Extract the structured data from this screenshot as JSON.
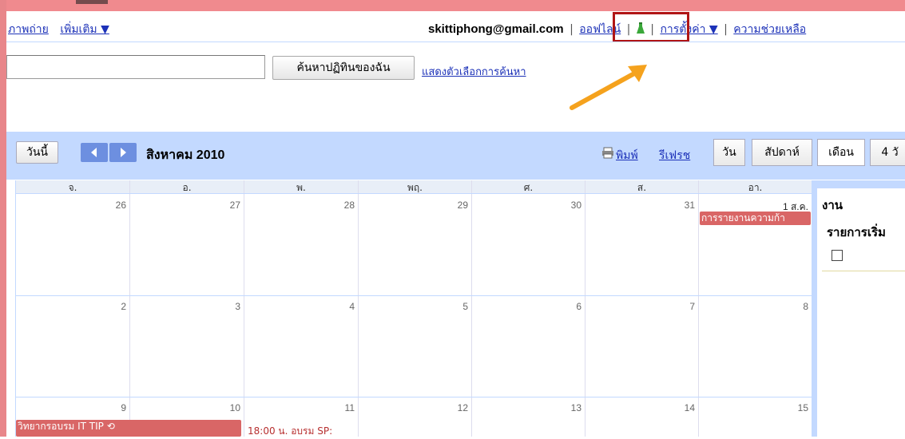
{
  "topnav": {
    "photos": "ภาพถ่าย",
    "more": "เพิ่มเติม ▼"
  },
  "account": {
    "email": "skittiphong@gmail.com",
    "offline": "ออฟไลน์",
    "settings": "การตั้งค่า ▼",
    "help": "ความช่วยเหลือ",
    "separator": "|"
  },
  "search": {
    "value": "",
    "button_label": "ค้นหาปฏิทินของฉัน",
    "options_link": "แสดงตัวเลือกการค้นหา"
  },
  "toolbar": {
    "today": "วันนี้",
    "month_title": "สิงหาคม 2010",
    "print": "พิมพ์",
    "refresh": "รีเฟรช",
    "views": [
      "วัน",
      "สัปดาห์",
      "เดือน",
      "4 วั"
    ],
    "active_view": "เดือน"
  },
  "calendar": {
    "weekdays": [
      "จ.",
      "อ.",
      "พ.",
      "พฤ.",
      "ศ.",
      "ส.",
      "อา."
    ],
    "weeks": [
      [
        "26",
        "27",
        "28",
        "29",
        "30",
        "31",
        "1 ส.ค."
      ],
      [
        "2",
        "3",
        "4",
        "5",
        "6",
        "7",
        "8"
      ],
      [
        "9",
        "10",
        "11",
        "12",
        "13",
        "14",
        "15"
      ]
    ],
    "events": {
      "aug1": "การรายงานความก้า",
      "aug9": "วิทยากรอบรม IT TIP ⟲",
      "aug11": "18:00 น. อบรม SP:"
    }
  },
  "tasks": {
    "title": "งาน",
    "list_title": "รายการเริ่ม"
  },
  "colors": {
    "accent": "#c3d9ff",
    "nav_button": "#6d8fe0",
    "event": "#d96666",
    "highlight_box": "#b01515",
    "arrow": "#f5a21d"
  }
}
